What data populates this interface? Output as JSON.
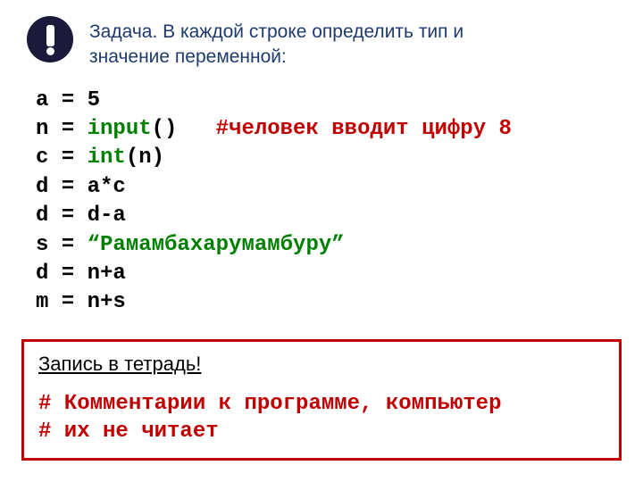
{
  "task": {
    "title": "Задача. В каждой строке определить тип и значение переменной:"
  },
  "code": {
    "l1_a": "a = ",
    "l1_b": "5",
    "l2_a": "n = ",
    "l2_b": "input",
    "l2_c": "()   ",
    "l2_d": "#человек вводит цифру 8",
    "l3_a": "c = ",
    "l3_b": "int",
    "l3_c": "(n)",
    "l4": "d = a*c",
    "l5": "d = d-a",
    "l6_a": "s = ",
    "l6_b": "“Рамамбахарумамбуру”",
    "l7": "d = n+a",
    "l8": "m = n+s"
  },
  "note": {
    "title": "Запись в тетрадь!",
    "line1": "# Комментарии к программе, компьютер",
    "line2": "# их не читает"
  }
}
